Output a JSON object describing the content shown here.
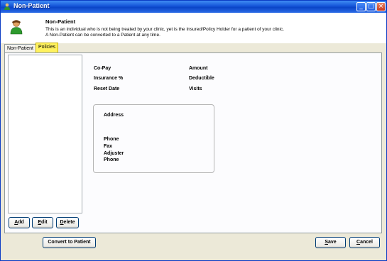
{
  "window": {
    "title": "Non-Patient",
    "controls": {
      "minimize": "_",
      "maximize": "□",
      "close": "×"
    }
  },
  "header": {
    "title": "Non-Patient",
    "description_line1": "This is an individual who is not being treated by your clinic, yet is the Insured/Policy Holder for a patient of your clinic.",
    "description_line2": "A Non-Patient can be converted to a Patient at any time.",
    "icon": "person-icon"
  },
  "tabs": [
    {
      "label": "Non-Patient",
      "active": false
    },
    {
      "label": "Policies",
      "active": true
    }
  ],
  "policies": {
    "list_buttons": {
      "add": {
        "mnemonic": "A",
        "rest": "dd"
      },
      "edit": {
        "mnemonic": "E",
        "rest": "dit"
      },
      "delete": {
        "mnemonic": "D",
        "rest": "elete"
      }
    },
    "fields": {
      "copay": "Co-Pay",
      "amount": "Amount",
      "insurance_pct": "Insurance %",
      "deductible": "Deductible",
      "reset_date": "Reset Date",
      "visits": "Visits"
    },
    "address_box": {
      "address": "Address",
      "phone": "Phone",
      "fax": "Fax",
      "adjuster": "Adjuster",
      "adjuster_phone": "Phone"
    }
  },
  "footer": {
    "convert": "Convert to Patient",
    "save": {
      "mnemonic": "S",
      "rest": "ave"
    },
    "cancel": {
      "mnemonic": "C",
      "rest": "ancel"
    }
  },
  "colors": {
    "titlebar": "#1454d8",
    "active_tab": "#fff25e",
    "window_bg": "#ece9d8"
  }
}
